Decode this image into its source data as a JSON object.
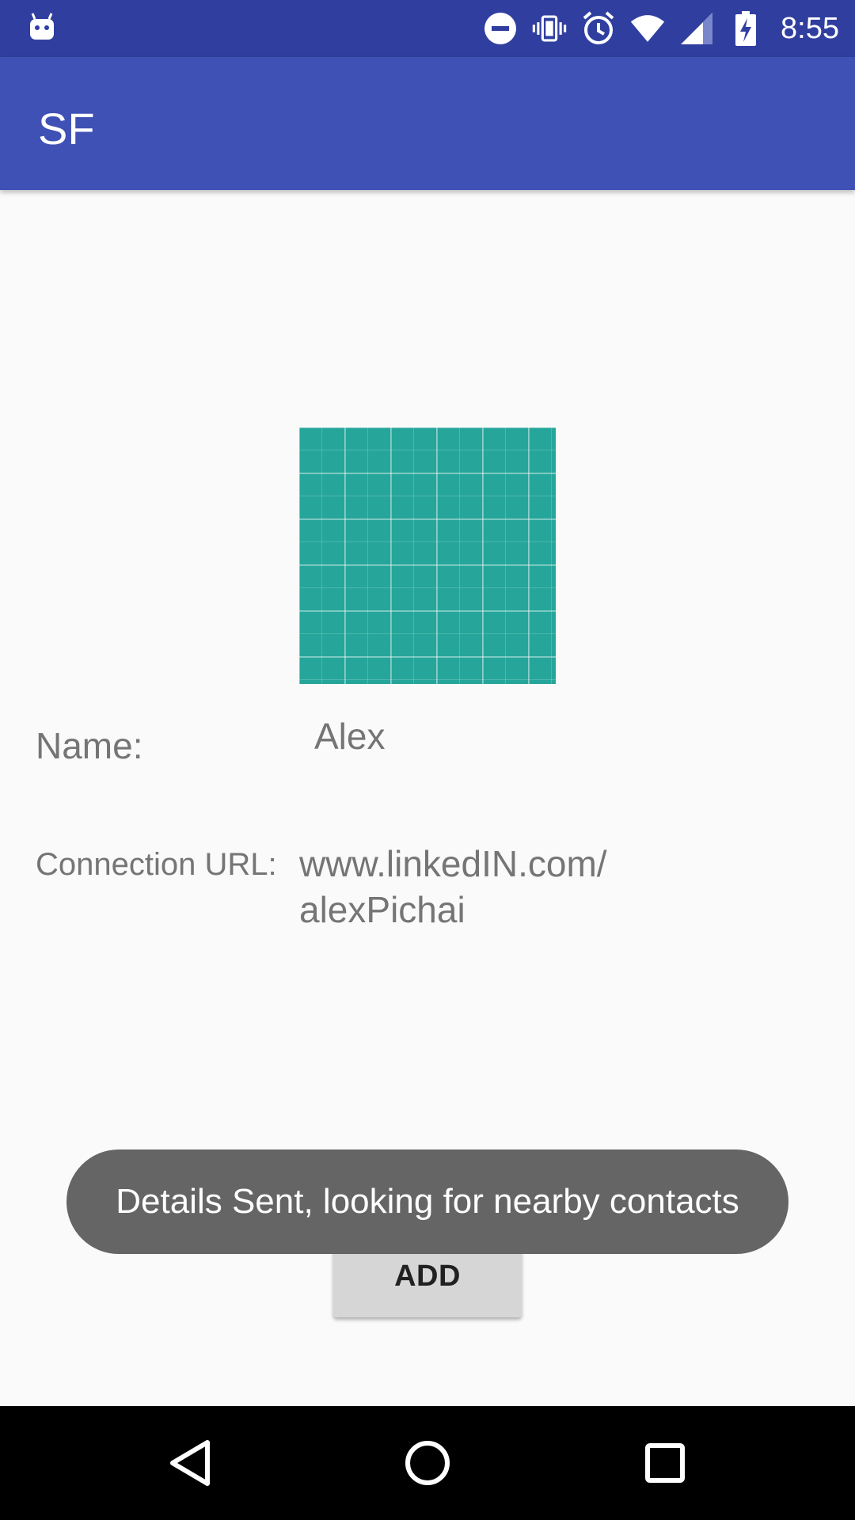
{
  "status_bar": {
    "time": "8:55",
    "icons": [
      "android-debug-icon",
      "do-not-disturb-icon",
      "vibrate-icon",
      "alarm-icon",
      "wifi-icon",
      "signal-icon",
      "battery-charging-icon"
    ]
  },
  "app_bar": {
    "title": "SF"
  },
  "profile": {
    "name_label": "Name:",
    "name_value": "Alex",
    "url_label": "Connection URL:",
    "url_value": "www.linkedIN.com/\nalexPichai"
  },
  "add_button": {
    "label": "ADD"
  },
  "toast": {
    "message": "Details Sent, looking for nearby contacts"
  },
  "colors": {
    "status_bar": "#303f9f",
    "app_bar": "#3f51b5",
    "photo": "#26a69a",
    "toast": "#656565"
  },
  "nav_bar": {
    "buttons": [
      "back-icon",
      "home-icon",
      "recents-icon"
    ]
  }
}
